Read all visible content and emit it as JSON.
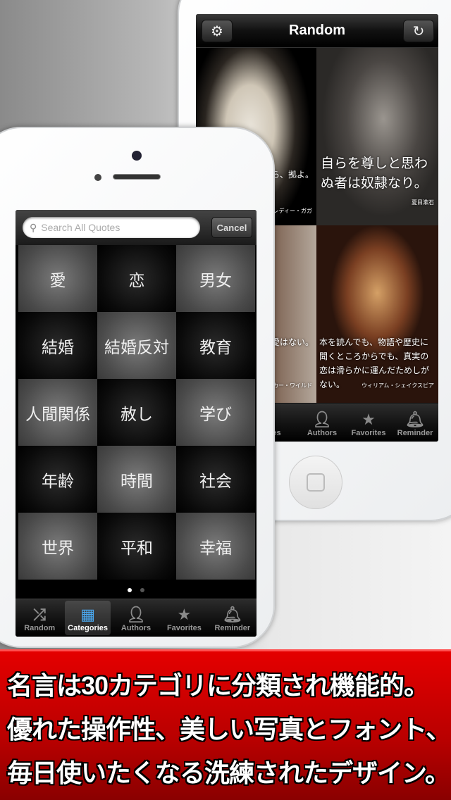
{
  "back_phone": {
    "nav": {
      "title": "Random",
      "left_icon": "gear-icon",
      "right_icon": "refresh-icon"
    },
    "quotes": [
      {
        "text": "のなら、拠よ。",
        "author": "レディー・ガガ"
      },
      {
        "text": "自らを尊しと思わぬ者は奴隷なり。",
        "author": "夏目漱石"
      },
      {
        "text": "はあり得拝、恋愛はない。",
        "author": "カー・ワイルド"
      },
      {
        "text": "本を読んでも、物語や歴史に聞くところからでも、真実の恋は滑らかに運んだためしがない。",
        "author": "ウィリアム・シェイクスピア"
      }
    ],
    "tabs": [
      {
        "label": "ies",
        "icon": "grid-icon"
      },
      {
        "label": "Authors",
        "icon": "person-icon"
      },
      {
        "label": "Favorites",
        "icon": "star-icon"
      },
      {
        "label": "Reminder",
        "icon": "bell-icon"
      }
    ]
  },
  "front_phone": {
    "search": {
      "placeholder": "Search All Quotes",
      "cancel_label": "Cancel"
    },
    "categories": [
      "愛",
      "恋",
      "男女",
      "結婚",
      "結婚反対",
      "教育",
      "人間関係",
      "赦し",
      "学び",
      "年齢",
      "時間",
      "社会",
      "世界",
      "平和",
      "幸福"
    ],
    "page_indicator": {
      "current": 1,
      "total": 2
    },
    "tabs": [
      {
        "label": "Random",
        "icon": "shuffle-icon",
        "active": false
      },
      {
        "label": "Categories",
        "icon": "grid-icon",
        "active": true
      },
      {
        "label": "Authors",
        "icon": "person-icon",
        "active": false
      },
      {
        "label": "Favorites",
        "icon": "star-icon",
        "active": false
      },
      {
        "label": "Reminder",
        "icon": "bell-icon",
        "active": false
      }
    ]
  },
  "banner": {
    "lines": [
      "名言は30カテゴリに分類され機能的。",
      "優れた操作性、美しい写真とフォント、",
      "毎日使いたくなる洗練されたデザイン。"
    ]
  },
  "colors": {
    "banner_red": "#d00000",
    "active_tab_icon": "#4aa8f0"
  }
}
